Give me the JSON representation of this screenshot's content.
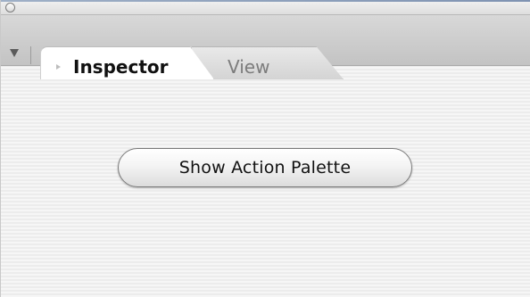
{
  "tabs": [
    {
      "label": "Inspector",
      "selected": true
    },
    {
      "label": "View",
      "selected": false
    }
  ],
  "main": {
    "button_label": "Show Action Palette"
  },
  "icons": {
    "close": "close-circle-icon",
    "collapse": "collapse-arrow-icon",
    "tab_indicator": "tab-triangle-icon"
  },
  "colors": {
    "selected_tab": "#ffffff",
    "inactive_tab": "#d4d4d4",
    "tab_strip": "#c3c3c3",
    "content_bg": "#f6f6f6"
  }
}
